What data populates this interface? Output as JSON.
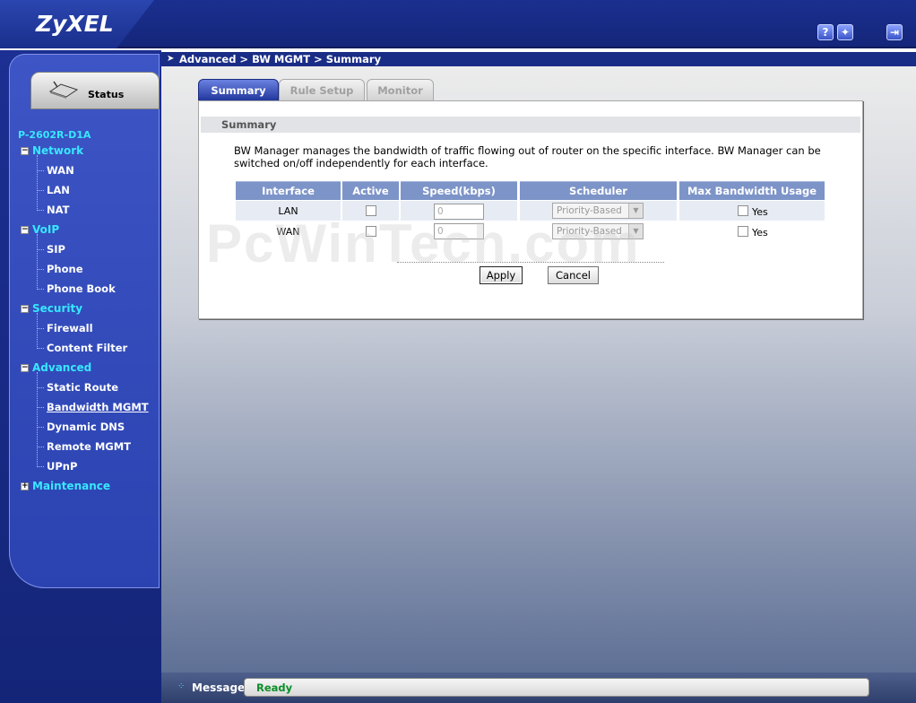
{
  "brand": {
    "logo": "ZyXEL"
  },
  "top_icons": [
    {
      "name": "help-icon",
      "glyph": "?"
    },
    {
      "name": "wizard-icon",
      "glyph": "✦"
    },
    {
      "name": "logout-icon",
      "glyph": "⇥"
    }
  ],
  "breadcrumb": "Advanced > BW MGMT > Summary",
  "sidebar": {
    "status_label": "Status",
    "device": "P-2602R-D1A",
    "groups": [
      {
        "label": "Network",
        "items": [
          "WAN",
          "LAN",
          "NAT"
        ]
      },
      {
        "label": "VoIP",
        "items": [
          "SIP",
          "Phone",
          "Phone Book"
        ]
      },
      {
        "label": "Security",
        "items": [
          "Firewall",
          "Content Filter"
        ]
      },
      {
        "label": "Advanced",
        "items": [
          "Static Route",
          "Bandwidth MGMT",
          "Dynamic DNS",
          "Remote MGMT",
          "UPnP"
        ]
      },
      {
        "label": "Maintenance",
        "items": []
      }
    ],
    "active_item": "Bandwidth MGMT"
  },
  "tabs": [
    "Summary",
    "Rule Setup",
    "Monitor"
  ],
  "active_tab": "Summary",
  "section_title": "Summary",
  "description": "BW Manager manages the bandwidth of traffic flowing out of router on the specific interface. BW Manager can be switched on/off independently for each interface.",
  "table": {
    "headers": [
      "Interface",
      "Active",
      "Speed(kbps)",
      "Scheduler",
      "Max Bandwidth Usage"
    ],
    "rows": [
      {
        "interface": "LAN",
        "active": false,
        "speed": "0",
        "scheduler": "Priority-Based",
        "max_usage": "Yes"
      },
      {
        "interface": "WAN",
        "active": false,
        "speed": "0",
        "scheduler": "Priority-Based",
        "max_usage": "Yes"
      }
    ]
  },
  "buttons": {
    "apply": "Apply",
    "cancel": "Cancel"
  },
  "watermark": "PcWinTech.com",
  "message": {
    "label": "Message",
    "text": "Ready"
  },
  "colors": {
    "accent_cyan": "#38e7ff",
    "brand_blue": "#1b2f8f",
    "status_green": "#0a8f28"
  }
}
